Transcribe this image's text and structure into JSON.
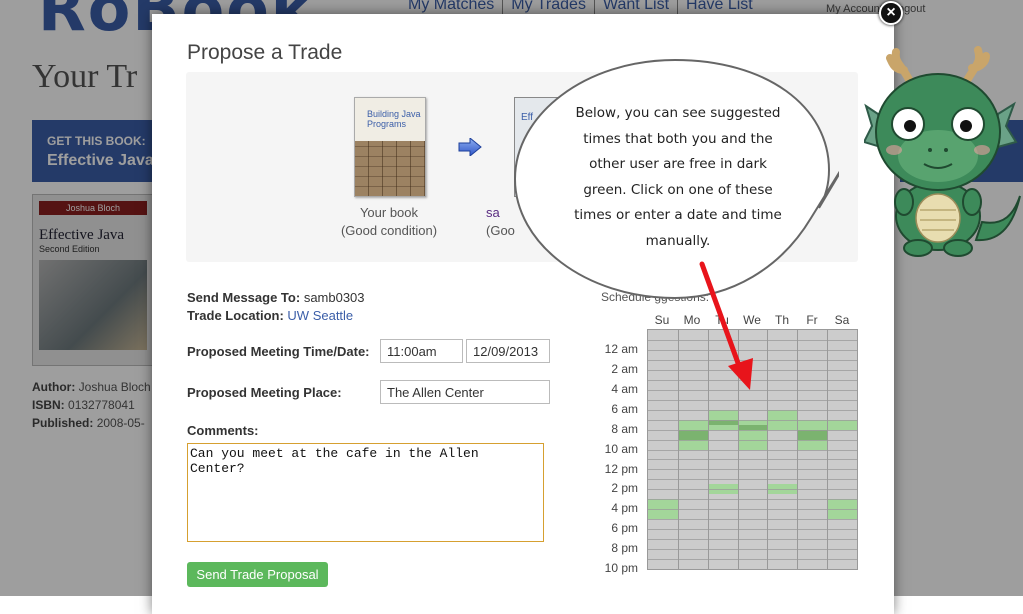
{
  "background": {
    "logo": "RoBook",
    "nav": [
      "My Matches",
      "My Trades",
      "Want List",
      "Have List"
    ],
    "account": "My Account | Logout",
    "page_title": "Your Tr",
    "get_book": {
      "label": "GET THIS BOOK:",
      "title": "Effective Java"
    },
    "cover": {
      "author": "Joshua Bloch",
      "title": "Effective Java",
      "edition": "Second Edition"
    },
    "meta": {
      "author_label": "Author:",
      "author": "Joshua Bloch",
      "isbn_label": "ISBN:",
      "isbn": "0132778041",
      "published_label": "Published:",
      "published": "2008-05-"
    }
  },
  "modal": {
    "title": "Propose a Trade",
    "close_icon": "close-icon",
    "your_book": {
      "cover_title": "Building Java Programs",
      "caption": "Your book",
      "condition": "(Good condition)"
    },
    "their_book": {
      "cover_title": "Eff",
      "caption": "sa",
      "condition": "(Goo"
    },
    "send_to_label": "Send Message To:",
    "send_to_value": "samb0303",
    "location_label": "Trade Location:",
    "location_value": "UW Seattle",
    "time_label": "Proposed Meeting Time/Date:",
    "time_value": "11:00am",
    "date_value": "12/09/2013",
    "place_label": "Proposed Meeting Place:",
    "place_value": "The Allen Center",
    "comments_label": "Comments:",
    "comments_value": "Can you meet at the cafe in the Allen Center?",
    "send_button": "Send Trade Proposal"
  },
  "schedule": {
    "title": "Schedule  ggestions:",
    "days": [
      "Su",
      "Mo",
      "Tu",
      "We",
      "Th",
      "Fr",
      "Sa"
    ],
    "hour_labels": [
      "12 am",
      "2 am",
      "4 am",
      "6 am",
      "8 am",
      "10 am",
      "12 pm",
      "2 pm",
      "4 pm",
      "6 pm",
      "8 pm",
      "10 pm"
    ],
    "colors": {
      "busy": "#cccccc",
      "free": "#a3d69a",
      "suggested": "#7bb36f",
      "grid_line": "#999999"
    },
    "free_slots": [
      {
        "day": 0,
        "from": 17,
        "to": 19
      },
      {
        "day": 1,
        "from": 9,
        "to": 12
      },
      {
        "day": 2,
        "from": 8,
        "to": 10
      },
      {
        "day": 2,
        "from": 15.5,
        "to": 16.5
      },
      {
        "day": 3,
        "from": 9,
        "to": 12
      },
      {
        "day": 4,
        "from": 8,
        "to": 10
      },
      {
        "day": 4,
        "from": 15.5,
        "to": 16.5
      },
      {
        "day": 5,
        "from": 9,
        "to": 12
      },
      {
        "day": 6,
        "from": 9,
        "to": 10
      },
      {
        "day": 6,
        "from": 17,
        "to": 19
      }
    ],
    "suggested_slots": [
      {
        "day": 1,
        "from": 10,
        "to": 11
      },
      {
        "day": 2,
        "from": 9,
        "to": 9.5
      },
      {
        "day": 3,
        "from": 9.5,
        "to": 10
      },
      {
        "day": 5,
        "from": 10,
        "to": 11
      }
    ]
  },
  "tutorial": {
    "bubble_text": "Below, you can see suggested times that both you and the other user are free in dark green. Click on one of these times or enter a date and time manually.",
    "mascot": "dragon-mascot",
    "arrow_color": "#e8141b"
  }
}
